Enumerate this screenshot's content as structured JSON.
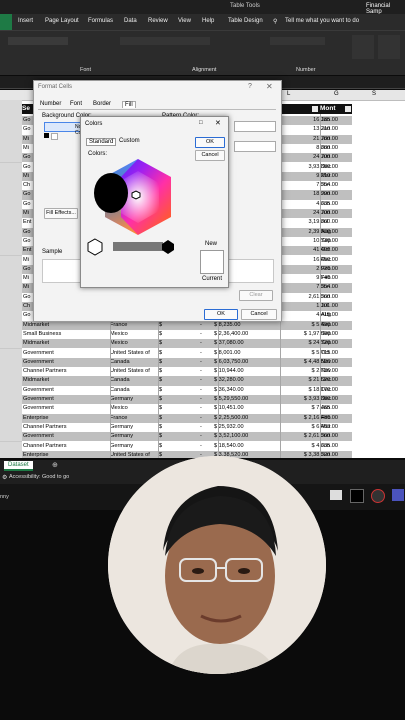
{
  "ribbon": {
    "context_title": "Table Tools",
    "file_title": "Financial Samp",
    "tabs": [
      "Insert",
      "Page Layout",
      "Formulas",
      "Data",
      "Review",
      "View",
      "Help",
      "Table Design"
    ],
    "tellme": "Tell me what you want to do",
    "groups": [
      "Font",
      "Alignment",
      "Number"
    ]
  },
  "table": {
    "headers": {
      "segment": "Se",
      "month": "Mont"
    },
    "col_letters": [
      "L",
      "G",
      "S"
    ],
    "rows": [
      {
        "seg": "Go",
        "v1": "16,185.00",
        "m": "Jan"
      },
      {
        "seg": "Go",
        "v1": "13,210.00",
        "m": "Jan"
      },
      {
        "seg": "Mi",
        "v1": "21,780.00",
        "m": "Jun"
      },
      {
        "seg": "Mi",
        "v1": "8,880.00",
        "m": "Jun"
      },
      {
        "seg": "Go",
        "v1": "24,700.00",
        "m": "Jun"
      },
      {
        "seg": "Go",
        "v1": "3,93,380.00",
        "m": "Dec"
      },
      {
        "seg": "Mi",
        "v1": "9,210.00",
        "m": "Mar"
      },
      {
        "seg": "Ch",
        "v1": "7,554.00",
        "m": "Jun"
      },
      {
        "seg": "Go",
        "v1": "18,990.00",
        "m": "Jun"
      },
      {
        "seg": "Go",
        "v1": "4,635.00",
        "m": "Jun"
      },
      {
        "seg": "Mi",
        "v1": "24,700.00",
        "m": "Jun"
      },
      {
        "seg": "Ent",
        "v1": "3,19,860.00",
        "m": "Jul"
      },
      {
        "seg": "Go",
        "v1": "2,39,500.00",
        "m": "Aug"
      },
      {
        "seg": "Go",
        "v1": "10,730.00",
        "m": "Sep"
      },
      {
        "seg": "Ent",
        "v1": "41,400.00",
        "m": "Oct"
      },
      {
        "seg": "Mi",
        "v1": "16,450.00",
        "m": "Dec"
      },
      {
        "seg": "Go",
        "v1": "2,920.00",
        "m": "Feb"
      },
      {
        "seg": "Mi",
        "v1": "9,740.00",
        "m": "Feb"
      },
      {
        "seg": "Mi",
        "v1": "7,554.00",
        "m": "Jun"
      },
      {
        "seg": "Go",
        "v1": "2,61,560.00",
        "m": "Jun"
      },
      {
        "seg": "Ch",
        "v1": "1,101.00",
        "m": "Jul"
      },
      {
        "seg": "Go",
        "v1": "4,415.00",
        "m": "Aug"
      }
    ],
    "full_rows": [
      {
        "seg": "Midmarket",
        "country": "France",
        "cur": "$",
        "dash": "-",
        "sales": "$ 8,235.00",
        "cogs": "$ 5,490.00",
        "m": "Sep"
      },
      {
        "seg": "Small Business",
        "country": "Mexico",
        "cur": "$",
        "dash": "-",
        "sales": "$ 2,36,400.00",
        "cogs": "$ 1,97,000.00",
        "m": "Sep"
      },
      {
        "seg": "Midmarket",
        "country": "Mexico",
        "cur": "$",
        "dash": "-",
        "sales": "$ 37,080.00",
        "cogs": "$ 24,720.00",
        "m": "Sep"
      },
      {
        "seg": "Government",
        "country": "United States of",
        "cur": "$",
        "dash": "-",
        "sales": "$ 8,001.00",
        "cogs": "$ 5,715.00",
        "m": "Oct"
      },
      {
        "seg": "Government",
        "country": "Canada",
        "cur": "$",
        "dash": "-",
        "sales": "$ 6,03,750.00",
        "cogs": "$ 4,48,500.00",
        "m": "Nov"
      },
      {
        "seg": "Channel Partners",
        "country": "United States of",
        "cur": "$",
        "dash": "-",
        "sales": "$ 10,944.00",
        "cogs": "$ 2,736.00",
        "m": "Nov"
      },
      {
        "seg": "Midmarket",
        "country": "Canada",
        "cur": "$",
        "dash": "-",
        "sales": "$ 32,280.00",
        "cogs": "$ 21,520.00",
        "m": "Dec"
      },
      {
        "seg": "Government",
        "country": "Canada",
        "cur": "$",
        "dash": "-",
        "sales": "$ 36,340.00",
        "cogs": "$ 18,170.00",
        "m": "Dec"
      },
      {
        "seg": "Government",
        "country": "Germany",
        "cur": "$",
        "dash": "-",
        "sales": "$ 5,29,550.00",
        "cogs": "$ 3,93,380.00",
        "m": "Dec"
      },
      {
        "seg": "Government",
        "country": "Mexico",
        "cur": "$",
        "dash": "-",
        "sales": "$ 10,451.00",
        "cogs": "$ 7,465.00",
        "m": "Jan"
      },
      {
        "seg": "Enterprise",
        "country": "France",
        "cur": "$",
        "dash": "-",
        "sales": "$ 2,25,500.00",
        "cogs": "$ 2,16,480.00",
        "m": "Feb"
      },
      {
        "seg": "Channel Partners",
        "country": "Germany",
        "cur": "$",
        "dash": "-",
        "sales": "$ 25,932.00",
        "cogs": "$ 6,483.00",
        "m": "Mar"
      },
      {
        "seg": "Government",
        "country": "Germany",
        "cur": "$",
        "dash": "-",
        "sales": "$ 3,52,100.00",
        "cogs": "$ 2,61,560.00",
        "m": "Jun"
      },
      {
        "seg": "Channel Partners",
        "country": "Germany",
        "cur": "$",
        "dash": "-",
        "sales": "$ 18,540.00",
        "cogs": "$ 4,635.00",
        "m": "Jun"
      },
      {
        "seg": "Enterprise",
        "country": "United States of",
        "cur": "$",
        "dash": "-",
        "sales": "$ 3,38,520.00",
        "cogs": "$ 3,38,520.00",
        "m": "Jun"
      }
    ]
  },
  "format_cells": {
    "title": "Format Cells",
    "tabs": [
      "Number",
      "Font",
      "Border",
      "Fill"
    ],
    "bg_label": "Background Color:",
    "no_color": "No Color",
    "pattern_color": "Pattern Color:",
    "fill_effects": "Fill Effects...",
    "sample": "Sample",
    "clear": "Clear",
    "ok": "OK",
    "cancel": "Cancel"
  },
  "colors_dialog": {
    "title": "Colors",
    "tabs": [
      "Standard",
      "Custom"
    ],
    "colors_label": "Colors:",
    "ok": "OK",
    "cancel": "Cancel",
    "new": "New",
    "current": "Current"
  },
  "sheet_tab": "Dataset",
  "status": "Accessibility: Good to go",
  "taskbar_left": "nny"
}
